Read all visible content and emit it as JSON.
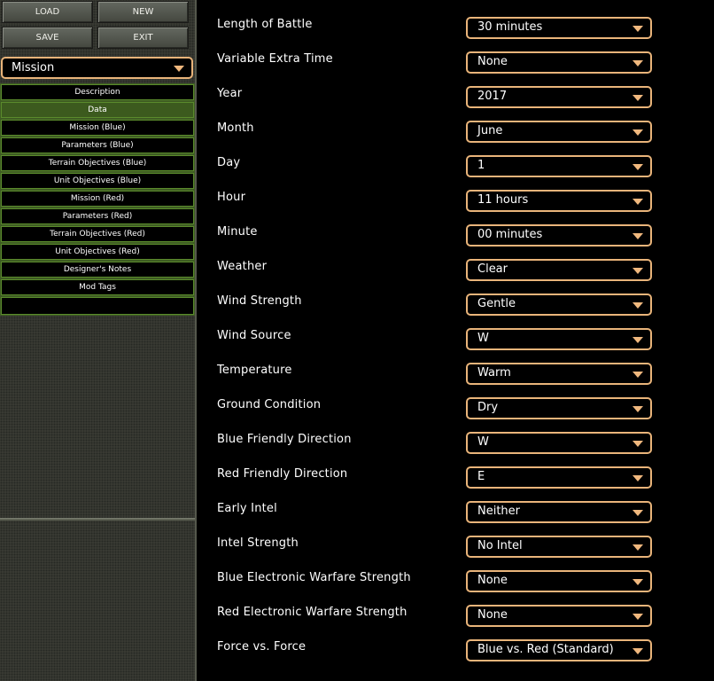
{
  "toolbar": {
    "load_label": "LOAD",
    "new_label": "NEW",
    "save_label": "SAVE",
    "exit_label": "EXIT"
  },
  "mode_select": {
    "value": "Mission"
  },
  "nav": {
    "items": [
      {
        "label": "Description"
      },
      {
        "label": "Data"
      },
      {
        "label": "Mission (Blue)"
      },
      {
        "label": "Parameters (Blue)"
      },
      {
        "label": "Terrain Objectives (Blue)"
      },
      {
        "label": "Unit Objectives (Blue)"
      },
      {
        "label": "Mission (Red)"
      },
      {
        "label": "Parameters (Red)"
      },
      {
        "label": "Terrain Objectives (Red)"
      },
      {
        "label": "Unit Objectives (Red)"
      },
      {
        "label": "Designer's Notes"
      },
      {
        "label": "Mod Tags"
      }
    ],
    "active": "Data"
  },
  "form": {
    "fields": [
      {
        "label": "Length of Battle",
        "value": "30 minutes"
      },
      {
        "label": "Variable Extra Time",
        "value": "None"
      },
      {
        "label": "Year",
        "value": "2017"
      },
      {
        "label": "Month",
        "value": "June"
      },
      {
        "label": "Day",
        "value": "1"
      },
      {
        "label": "Hour",
        "value": "11 hours"
      },
      {
        "label": "Minute",
        "value": "00 minutes"
      },
      {
        "label": "Weather",
        "value": "Clear"
      },
      {
        "label": "Wind Strength",
        "value": "Gentle"
      },
      {
        "label": "Wind Source",
        "value": "W"
      },
      {
        "label": "Temperature",
        "value": "Warm"
      },
      {
        "label": "Ground Condition",
        "value": "Dry"
      },
      {
        "label": "Blue Friendly Direction",
        "value": "W"
      },
      {
        "label": "Red Friendly Direction",
        "value": "E"
      },
      {
        "label": "Early Intel",
        "value": "Neither"
      },
      {
        "label": "Intel Strength",
        "value": "No Intel"
      },
      {
        "label": "Blue Electronic Warfare Strength",
        "value": "None"
      },
      {
        "label": "Red Electronic Warfare Strength",
        "value": "None"
      },
      {
        "label": "Force vs. Force",
        "value": "Blue vs. Red (Standard)"
      }
    ]
  },
  "colors": {
    "accent_border": "#e9b47a",
    "nav_active": "#3c5a1e",
    "nav_border": "#5a8a2c",
    "sidebar_bg": "#3b3d35"
  },
  "icons": {
    "dropdown": "chevron-down-icon"
  }
}
